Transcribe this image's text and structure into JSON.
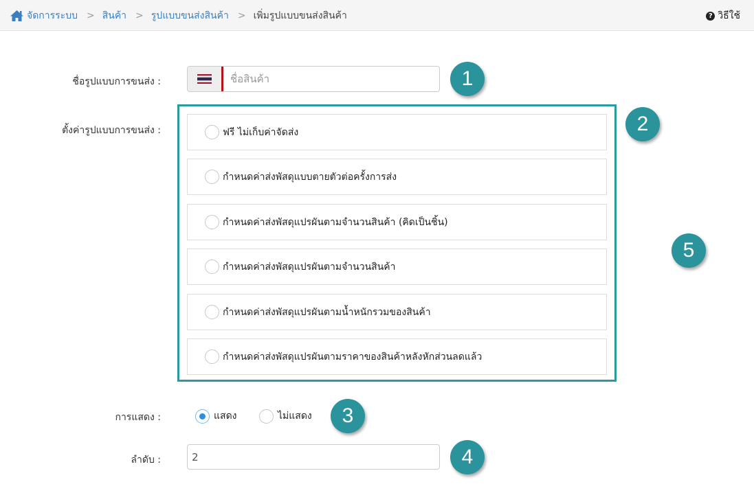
{
  "breadcrumb": {
    "items": [
      "จัดการระบบ",
      "สินค้า",
      "รูปแบบขนส่งสินค้า"
    ],
    "current": "เพิ่มรูปแบบขนส่งสินค้า",
    "separator": ">"
  },
  "help": {
    "label": "วิธีใช้",
    "icon": "question-circle-icon"
  },
  "form": {
    "name_label": "ชื่อรูปแบบการขนส่ง :",
    "name_placeholder": "ชื่อสินค้า",
    "name_value": "",
    "flag_icon": "thai-flag-icon",
    "setting_label": "ตั้งค่ารูปแบบการขนส่ง :",
    "shipping_options": [
      "ฟรี ไม่เก็บค่าจัดส่ง",
      "กำหนดค่าส่งพัสดุแบบตายตัวต่อครั้งการส่ง",
      "กำหนดค่าส่งพัสดุแปรผันตามจำนวนสินค้า (คิดเป็นชิ้น)",
      "กำหนดค่าส่งพัสดุแปรผันตามจำนวนสินค้า",
      "กำหนดค่าส่งพัสดุแปรผันตามน้ำหนักรวมของสินค้า",
      "กำหนดค่าส่งพัสดุแปรผันตามราคาของสินค้าหลังหักส่วนลดแล้ว"
    ],
    "display_label": "การแสดง :",
    "display_options": [
      {
        "label": "แสดง",
        "checked": true
      },
      {
        "label": "ไม่แสดง",
        "checked": false
      }
    ],
    "order_label": "ลำดับ :",
    "order_value": "2"
  },
  "badges": [
    "1",
    "2",
    "3",
    "4",
    "5"
  ],
  "colors": {
    "accent": "#2a939b",
    "frame": "#2a9a9f",
    "link": "#3a7fc1",
    "radio_checked": "#2f8fdc",
    "flag_red": "#b3141c"
  }
}
